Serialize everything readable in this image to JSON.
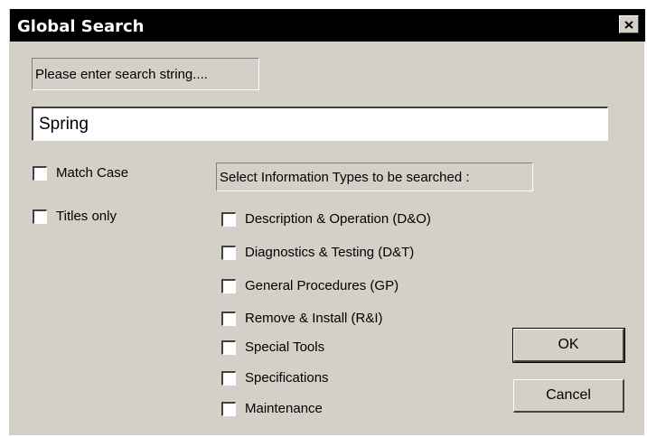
{
  "window": {
    "title": "Global Search",
    "close_label": "Close"
  },
  "search": {
    "prompt": "Please enter search string....",
    "value": "Spring"
  },
  "options": {
    "match_case": "Match Case",
    "titles_only": "Titles only"
  },
  "info_types": {
    "label": "Select Information Types to be searched :",
    "items": [
      "Description & Operation (D&O)",
      "Diagnostics & Testing (D&T)",
      "General Procedures (GP)",
      "Remove & Install (R&I)",
      "Special Tools",
      "Specifications",
      "Maintenance"
    ]
  },
  "buttons": {
    "ok": "OK",
    "cancel": "Cancel"
  }
}
